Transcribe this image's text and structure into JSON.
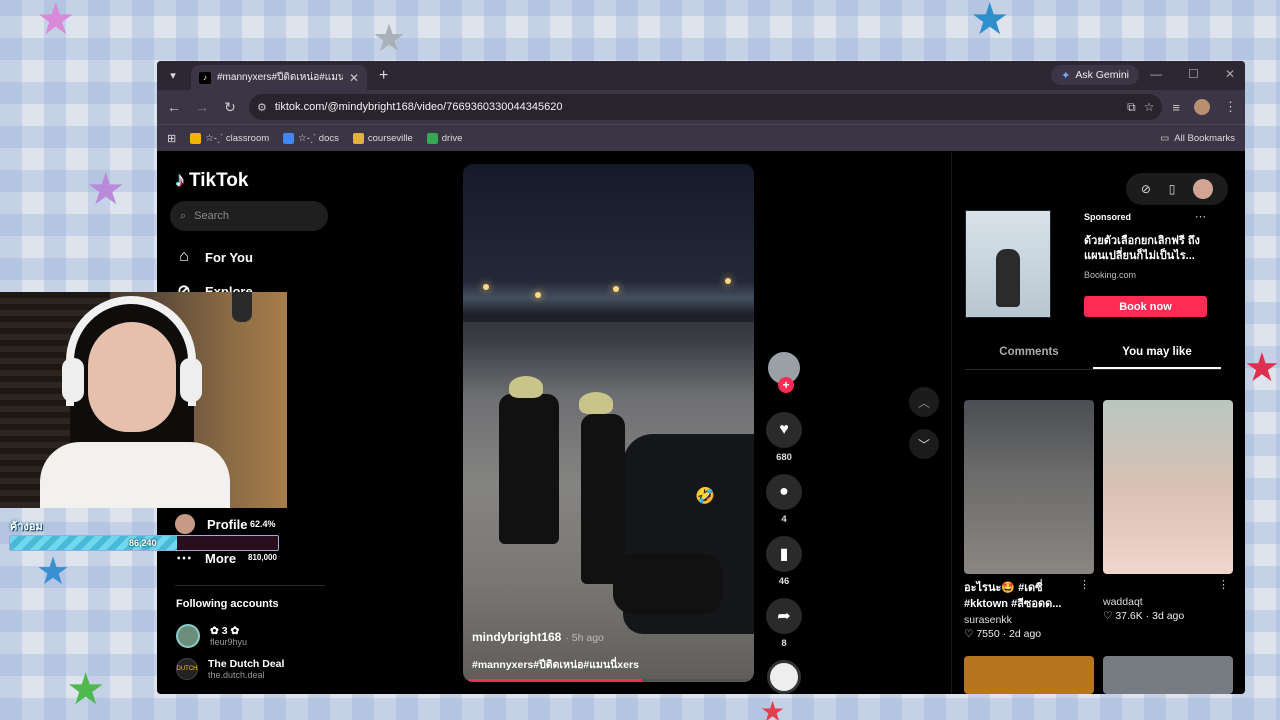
{
  "browser": {
    "tab_title": "#mannyxers#ปีติดเหน่อ#แมนนี่xers",
    "ask_gemini": "Ask Gemini",
    "url": "tiktok.com/@mindybright168/video/7669360330044345620",
    "bookmarks": [
      {
        "label": "☆-ˏˋ classroom",
        "color": "#f4b400"
      },
      {
        "label": "☆-ˏˋ docs",
        "color": "#4285f4"
      },
      {
        "label": "courseville",
        "color": "#e2b23a"
      },
      {
        "label": "drive",
        "color": "#34a853"
      }
    ],
    "all_bookmarks": "All Bookmarks"
  },
  "sidebar": {
    "logo": "TikTok",
    "search_placeholder": "Search",
    "for_you": "For You",
    "explore": "Explore",
    "profile": "Profile",
    "more": "More",
    "following_header": "Following accounts",
    "accounts": [
      {
        "name": "✿ 3 ✿",
        "handle": "fleur9hyu"
      },
      {
        "name": "The Dutch Deal",
        "handle": "the.dutch.deal"
      }
    ]
  },
  "video": {
    "username": "mindybright168",
    "ago": "· 5h ago",
    "caption": "#mannyxers#ปีติดเหน่อ#แมนนี่xers",
    "progress": 0.62,
    "likes": "680",
    "comments": "4",
    "saves": "46",
    "shares": "8"
  },
  "ad": {
    "sponsored": "Sponsored",
    "title": "ด้วยตัวเลือกยกเลิกฟรี ถึงแผนเปลี่ยนก็ไม่เป็นไร...",
    "domain": "Booking.com",
    "button": "Book now"
  },
  "right_tabs": [
    "Comments",
    "You may like"
  ],
  "cards": [
    {
      "title": "อะไรนะ🤩 #เดซี่ #kktown #ลีซอดด...",
      "author": "surasenkk",
      "meta": "♡ 7550 · 2d ago"
    },
    {
      "title": "",
      "author": "waddaqt",
      "meta": "♡ 37.6K · 3d ago"
    }
  ],
  "overlay": {
    "goal_label": "ค้างอม",
    "goal_value": "86,240",
    "goal_percent": "62.4%",
    "goal_target": "810,000",
    "goal_fraction": 0.624
  },
  "colors": {
    "accent": "#fe2c55",
    "background": "#000000"
  }
}
